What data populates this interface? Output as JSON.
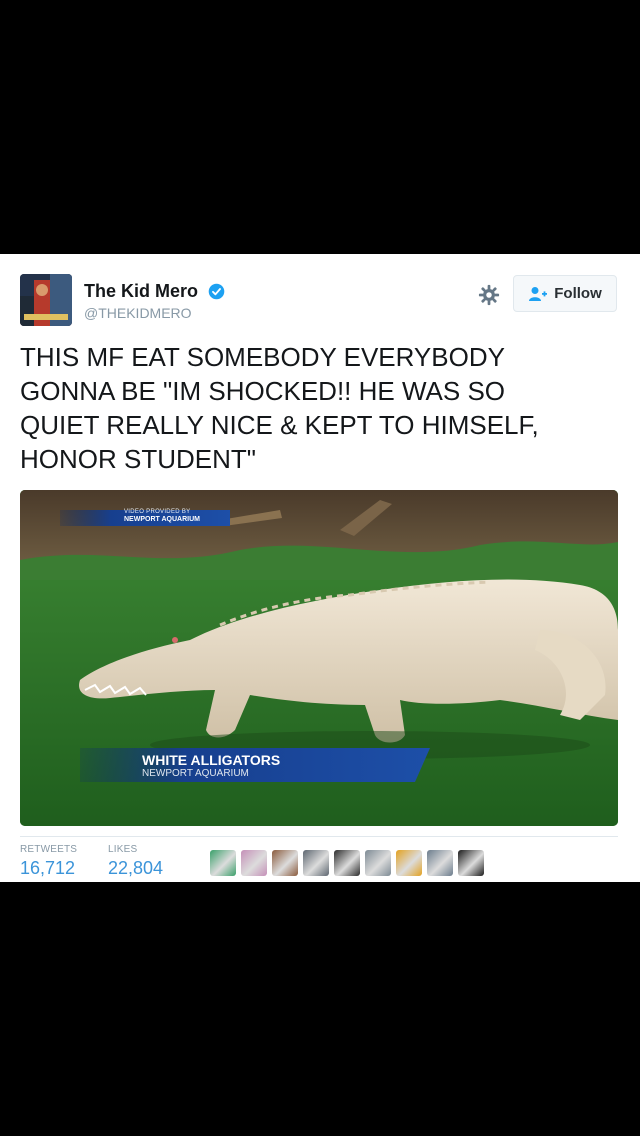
{
  "tweet": {
    "author_name": "The Kid Mero",
    "author_handle": "@THEKIDMERO",
    "verified_icon": "verified-badge-icon",
    "follow_label": "Follow",
    "text": "THIS MF EAT SOMEBODY EVERYBODY\nGONNA BE \"IM SHOCKED!! HE WAS SO\nQUIET REALLY NICE & KEPT TO HIMSELF,\nHONOR STUDENT\""
  },
  "media": {
    "chyron_small_top": "VIDEO PROVIDED BY",
    "chyron_small_main": "NEWPORT AQUARIUM",
    "chyron_title": "WHITE ALLIGATORS",
    "chyron_subtitle": "NEWPORT AQUARIUM"
  },
  "stats": {
    "retweets_label": "RETWEETS",
    "retweets_value": "16,712",
    "likes_label": "LIKES",
    "likes_value": "22,804"
  },
  "colors": {
    "link_blue": "#3b94d9",
    "verified_blue": "#1da1f2",
    "text_dark": "#14171a",
    "muted_gray": "#8899a6"
  },
  "likers": [
    {
      "color": "#3aa06a"
    },
    {
      "color": "#c58fb8"
    },
    {
      "color": "#8a5a3c"
    },
    {
      "color": "#5d6670"
    },
    {
      "color": "#2b2b2b"
    },
    {
      "color": "#7d8a94"
    },
    {
      "color": "#e3a11f"
    },
    {
      "color": "#6b7c8c"
    },
    {
      "color": "#1a1a1a"
    }
  ]
}
